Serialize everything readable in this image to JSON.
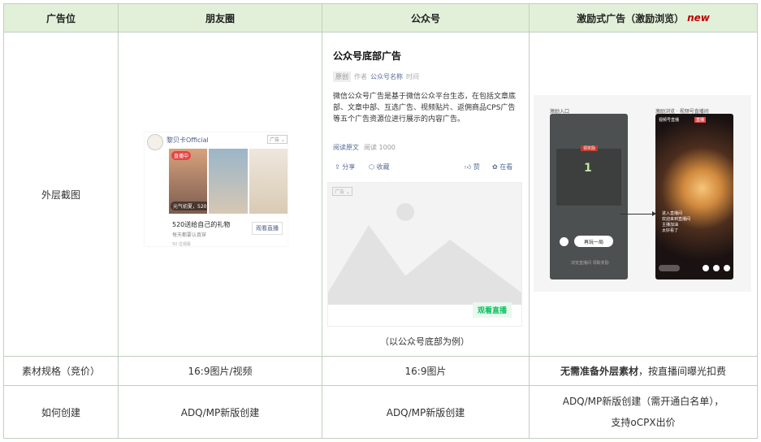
{
  "headers": {
    "col1": "广告位",
    "col2": "朋友圈",
    "col3": "公众号",
    "col4": "激励式广告（激励浏览）",
    "col4_new": "new"
  },
  "rows": {
    "screenshot_label": "外层截图",
    "spec_label": "素材规格（竞价）",
    "spec_moments": "16:9图片/视频",
    "spec_oa": "16:9图片",
    "spec_incentive_bold": "无需准备外层素材",
    "spec_incentive_rest": "，按直播间曝光扣费",
    "create_label": "如何创建",
    "create_moments": "ADQ/MP新版创建",
    "create_oa": "ADQ/MP新版创建",
    "create_incentive_line1": "ADQ/MP新版创建（需开通白名单），",
    "create_incentive_line2": "支持oCPX出价"
  },
  "moments_card": {
    "account": "黎贝卡Official",
    "ad_tag": "广告 ⌄",
    "live_badge": "直播中",
    "promo": "元气初夏，520直播开启",
    "gift_title": "520送给自己的礼物",
    "gift_sub": "每天都要认真穿",
    "watch_button": "观看直播",
    "watchers": "50 位观看"
  },
  "oa_card": {
    "title": "公众号底部广告",
    "original_tag": "原创",
    "author": "作者",
    "account_name": "公众号名称",
    "time": "时间",
    "description": "微信公众号广告是基于微信公众平台生态，在包括文章底部、文章中部、互选广告、视频贴片、返佣商品CPS广告等五个广告资源位进行展示的内容广告。",
    "read_original": "阅读原文",
    "read_count": "阅读 1000",
    "share": "分享",
    "collect": "收藏",
    "like": "赞",
    "watching": "在看",
    "ad_tag": "广告 ⌄",
    "cta": "观看直播",
    "caption": "（以公众号底部为例）"
  },
  "incentive_card": {
    "entry_label": "激励入口",
    "live_label": "激励浏览 · 视频号直播间",
    "modal_tag": "领奖励",
    "modal_number": "1",
    "button": "再玩一局",
    "foot": "浏览直播间 领取奖励",
    "live_name": "视频号直播",
    "live_red": "直播",
    "chat1": "进入直播间",
    "chat2": "欢迎来到直播间",
    "chat3": "主播加油",
    "chat4": "太好看了"
  }
}
